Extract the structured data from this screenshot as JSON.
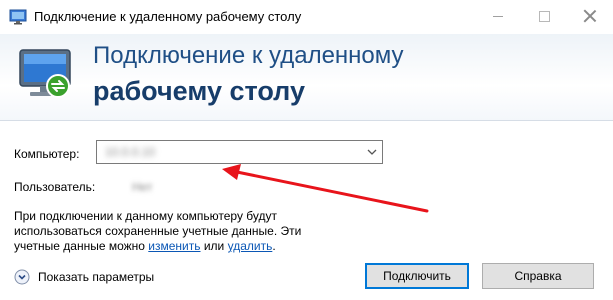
{
  "window": {
    "title": "Подключение к удаленному рабочему столу"
  },
  "banner": {
    "line1": "Подключение к удаленному",
    "line2": "рабочему столу"
  },
  "form": {
    "computer_label": "Компьютер:",
    "computer_value": "10.0.0.10",
    "user_label": "Пользователь:",
    "user_value": "Нет"
  },
  "info": {
    "line1": "При подключении к данному компьютеру будут",
    "line2": "использоваться сохраненные учетные данные. Эти",
    "line3_prefix": "учетные данные можно ",
    "change_link": "изменить",
    "or_text": " или ",
    "delete_link": "удалить",
    "period": "."
  },
  "footer": {
    "show_params_label": "Показать параметры",
    "connect_label": "Подключить",
    "help_label": "Справка"
  },
  "colors": {
    "annotation_arrow": "#e8141b",
    "banner_text": "#1f4f86",
    "link": "#0b57b5"
  }
}
